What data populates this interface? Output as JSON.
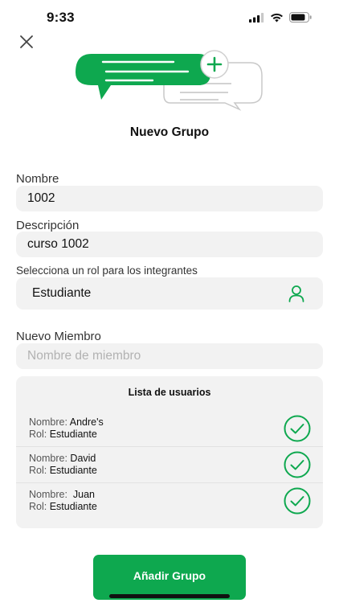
{
  "status_bar": {
    "time": "9:33"
  },
  "header": {
    "title": "Nuevo Grupo"
  },
  "form": {
    "name_label": "Nombre",
    "name_value": "1002",
    "description_label": "Descripción",
    "description_value": "curso 1002",
    "role_label": "Selecciona un rol para los integrantes",
    "role_value": "Estudiante",
    "role_icon": "person-icon",
    "member_label": "Nuevo Miembro",
    "member_placeholder": "Nombre de miembro"
  },
  "user_list": {
    "title": "Lista de usuarios",
    "name_prefix": "Nombre:",
    "role_prefix": "Rol:",
    "users": [
      {
        "name": "Andre's",
        "role": "Estudiante"
      },
      {
        "name": "David",
        "role": "Estudiante"
      },
      {
        "name": " Juan",
        "role": "Estudiante"
      }
    ]
  },
  "actions": {
    "add_group_label": "Añadir Grupo"
  },
  "colors": {
    "accent": "#0ea84f",
    "field_bg": "#f2f2f2"
  }
}
